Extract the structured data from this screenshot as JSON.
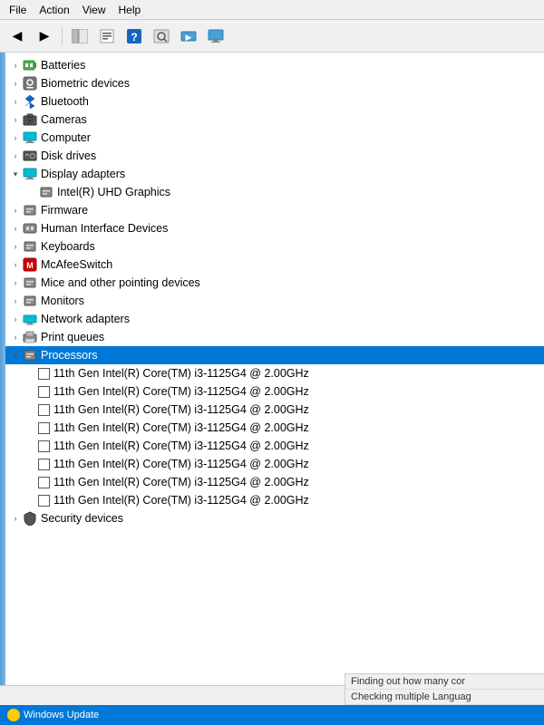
{
  "menubar": {
    "items": [
      "File",
      "Action",
      "View",
      "Help"
    ]
  },
  "toolbar": {
    "buttons": [
      {
        "name": "back-button",
        "icon": "◀",
        "disabled": false
      },
      {
        "name": "forward-button",
        "icon": "▶",
        "disabled": false
      },
      {
        "name": "show-hide-button",
        "icon": "🖥",
        "disabled": false
      },
      {
        "name": "properties-button",
        "icon": "📄",
        "disabled": false
      },
      {
        "name": "help-button",
        "icon": "❓",
        "disabled": false
      },
      {
        "name": "scan-button",
        "icon": "📋",
        "disabled": false
      },
      {
        "name": "update-button",
        "icon": "⬛",
        "disabled": false
      },
      {
        "name": "display-button",
        "icon": "🖥",
        "disabled": false
      }
    ]
  },
  "tree": {
    "items": [
      {
        "id": "batteries",
        "label": "Batteries",
        "indent": 1,
        "expanded": false,
        "arrow": true,
        "icon": "🔋",
        "icon_class": "icon-battery"
      },
      {
        "id": "biometric",
        "label": "Biometric devices",
        "indent": 1,
        "expanded": false,
        "arrow": true,
        "icon": "🔒",
        "icon_class": "icon-biometric"
      },
      {
        "id": "bluetooth",
        "label": "Bluetooth",
        "indent": 1,
        "expanded": false,
        "arrow": true,
        "icon": "🔷",
        "icon_class": "icon-bluetooth"
      },
      {
        "id": "cameras",
        "label": "Cameras",
        "indent": 1,
        "expanded": false,
        "arrow": true,
        "icon": "📷",
        "icon_class": "icon-camera"
      },
      {
        "id": "computer",
        "label": "Computer",
        "indent": 1,
        "expanded": false,
        "arrow": true,
        "icon": "🖥",
        "icon_class": "icon-computer"
      },
      {
        "id": "disk",
        "label": "Disk drives",
        "indent": 1,
        "expanded": false,
        "arrow": true,
        "icon": "💾",
        "icon_class": "icon-disk"
      },
      {
        "id": "display",
        "label": "Display adapters",
        "indent": 1,
        "expanded": true,
        "arrow": true,
        "icon": "🖥",
        "icon_class": "icon-display"
      },
      {
        "id": "intel-uhd",
        "label": "Intel(R) UHD Graphics",
        "indent": 2,
        "expanded": false,
        "arrow": false,
        "icon": "🖥",
        "icon_class": "icon-display"
      },
      {
        "id": "firmware",
        "label": "Firmware",
        "indent": 1,
        "expanded": false,
        "arrow": true,
        "icon": "📦",
        "icon_class": "icon-firmware"
      },
      {
        "id": "hid",
        "label": "Human Interface Devices",
        "indent": 1,
        "expanded": false,
        "arrow": true,
        "icon": "🔧",
        "icon_class": "icon-hid"
      },
      {
        "id": "keyboards",
        "label": "Keyboards",
        "indent": 1,
        "expanded": false,
        "arrow": true,
        "icon": "⌨",
        "icon_class": "icon-keyboard"
      },
      {
        "id": "mcafee",
        "label": "McAfeeSwitch",
        "indent": 1,
        "expanded": false,
        "arrow": true,
        "icon": "🛡",
        "icon_class": "icon-mcafee"
      },
      {
        "id": "mice",
        "label": "Mice and other pointing devices",
        "indent": 1,
        "expanded": false,
        "arrow": true,
        "icon": "🖱",
        "icon_class": "icon-mouse"
      },
      {
        "id": "monitors",
        "label": "Monitors",
        "indent": 1,
        "expanded": false,
        "arrow": true,
        "icon": "🖥",
        "icon_class": "icon-monitor"
      },
      {
        "id": "network",
        "label": "Network adapters",
        "indent": 1,
        "expanded": false,
        "arrow": true,
        "icon": "🌐",
        "icon_class": "icon-network"
      },
      {
        "id": "print",
        "label": "Print queues",
        "indent": 1,
        "expanded": false,
        "arrow": true,
        "icon": "🖨",
        "icon_class": "icon-print"
      },
      {
        "id": "processors",
        "label": "Processors",
        "indent": 1,
        "expanded": true,
        "arrow": true,
        "icon": "⬜",
        "icon_class": "icon-processor",
        "selected": true
      },
      {
        "id": "proc1",
        "label": "11th Gen Intel(R) Core(TM) i3-1125G4 @ 2.00GHz",
        "indent": 2,
        "expanded": false,
        "arrow": false,
        "icon": "proc",
        "icon_class": "icon-processor"
      },
      {
        "id": "proc2",
        "label": "11th Gen Intel(R) Core(TM) i3-1125G4 @ 2.00GHz",
        "indent": 2,
        "expanded": false,
        "arrow": false,
        "icon": "proc",
        "icon_class": "icon-processor"
      },
      {
        "id": "proc3",
        "label": "11th Gen Intel(R) Core(TM) i3-1125G4 @ 2.00GHz",
        "indent": 2,
        "expanded": false,
        "arrow": false,
        "icon": "proc",
        "icon_class": "icon-processor"
      },
      {
        "id": "proc4",
        "label": "11th Gen Intel(R) Core(TM) i3-1125G4 @ 2.00GHz",
        "indent": 2,
        "expanded": false,
        "arrow": false,
        "icon": "proc",
        "icon_class": "icon-processor"
      },
      {
        "id": "proc5",
        "label": "11th Gen Intel(R) Core(TM) i3-1125G4 @ 2.00GHz",
        "indent": 2,
        "expanded": false,
        "arrow": false,
        "icon": "proc",
        "icon_class": "icon-processor"
      },
      {
        "id": "proc6",
        "label": "11th Gen Intel(R) Core(TM) i3-1125G4 @ 2.00GHz",
        "indent": 2,
        "expanded": false,
        "arrow": false,
        "icon": "proc",
        "icon_class": "icon-processor"
      },
      {
        "id": "proc7",
        "label": "11th Gen Intel(R) Core(TM) i3-1125G4 @ 2.00GHz",
        "indent": 2,
        "expanded": false,
        "arrow": false,
        "icon": "proc",
        "icon_class": "icon-processor"
      },
      {
        "id": "proc8",
        "label": "11th Gen Intel(R) Core(TM) i3-1125G4 @ 2.00GHz",
        "indent": 2,
        "expanded": false,
        "arrow": false,
        "icon": "proc",
        "icon_class": "icon-processor"
      },
      {
        "id": "security",
        "label": "Security devices",
        "indent": 1,
        "expanded": false,
        "arrow": true,
        "icon": "🔒",
        "icon_class": "icon-security"
      }
    ]
  },
  "statusbar": {
    "text": ""
  },
  "bottombar": {
    "items": [
      {
        "icon": "circle",
        "label": "Windows Update"
      }
    ]
  },
  "status_messages": [
    "Finding out how many cor",
    "Checking multiple Languag"
  ]
}
